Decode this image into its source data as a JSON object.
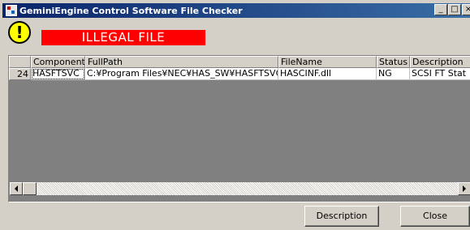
{
  "window": {
    "title": "GeminiEngine Control Software File Checker",
    "minimize_glyph": "_",
    "maximize_glyph": "□",
    "close_glyph": "×"
  },
  "banner": {
    "text": "ILLEGAL FILE",
    "color": "#ff0000",
    "icon": "exclamation-warning-icon",
    "icon_glyph": "!"
  },
  "grid": {
    "columns": [
      "Component",
      "FullPath",
      "FileName",
      "Status",
      "Description"
    ],
    "rows": [
      {
        "number": "24",
        "cells": [
          "HASFTSVC",
          "C:¥Program Files¥NEC¥HAS_SW¥HASFTSVC",
          "HASCINF.dll",
          "NG",
          "SCSI FT Stat"
        ]
      }
    ]
  },
  "buttons": {
    "description": "Description",
    "close": "Close"
  }
}
